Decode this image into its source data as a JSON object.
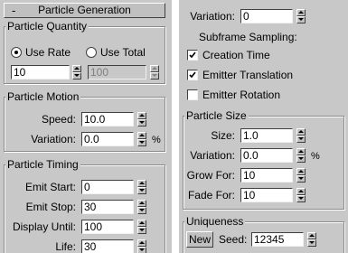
{
  "left_panel": {
    "rollout_toggle": "-",
    "rollout_title": "Particle Generation",
    "quantity": {
      "legend": "Particle Quantity",
      "use_rate_label": "Use Rate",
      "use_total_label": "Use Total",
      "selected": "Use Rate",
      "rate_value": "10",
      "total_value": "100"
    },
    "motion": {
      "legend": "Particle Motion",
      "speed_label": "Speed:",
      "speed_value": "10.0",
      "variation_label": "Variation:",
      "variation_value": "0.0",
      "variation_unit": "%"
    },
    "timing": {
      "legend": "Particle Timing",
      "emit_start_label": "Emit Start:",
      "emit_start_value": "0",
      "emit_stop_label": "Emit Stop:",
      "emit_stop_value": "30",
      "display_until_label": "Display Until:",
      "display_until_value": "100",
      "life_label": "Life:",
      "life_value": "30"
    }
  },
  "right_panel": {
    "variation_label": "Variation:",
    "variation_value": "0",
    "subframe_label": "Subframe Sampling:",
    "creation_time_label": "Creation Time",
    "creation_time_checked": true,
    "emitter_translation_label": "Emitter Translation",
    "emitter_translation_checked": true,
    "emitter_rotation_label": "Emitter Rotation",
    "emitter_rotation_checked": false,
    "size": {
      "legend": "Particle Size",
      "size_label": "Size:",
      "size_value": "1.0",
      "variation_label": "Variation:",
      "variation_value": "0.0",
      "variation_unit": "%",
      "grow_for_label": "Grow For:",
      "grow_for_value": "10",
      "fade_for_label": "Fade For:",
      "fade_for_value": "10"
    },
    "uniqueness": {
      "legend": "Uniqueness",
      "new_button": "New",
      "seed_label": "Seed:",
      "seed_value": "12345"
    }
  },
  "colors": {
    "panel_bg": "#c8c8c8",
    "field_bg": "#ffffff",
    "divider": "#ffffff"
  }
}
